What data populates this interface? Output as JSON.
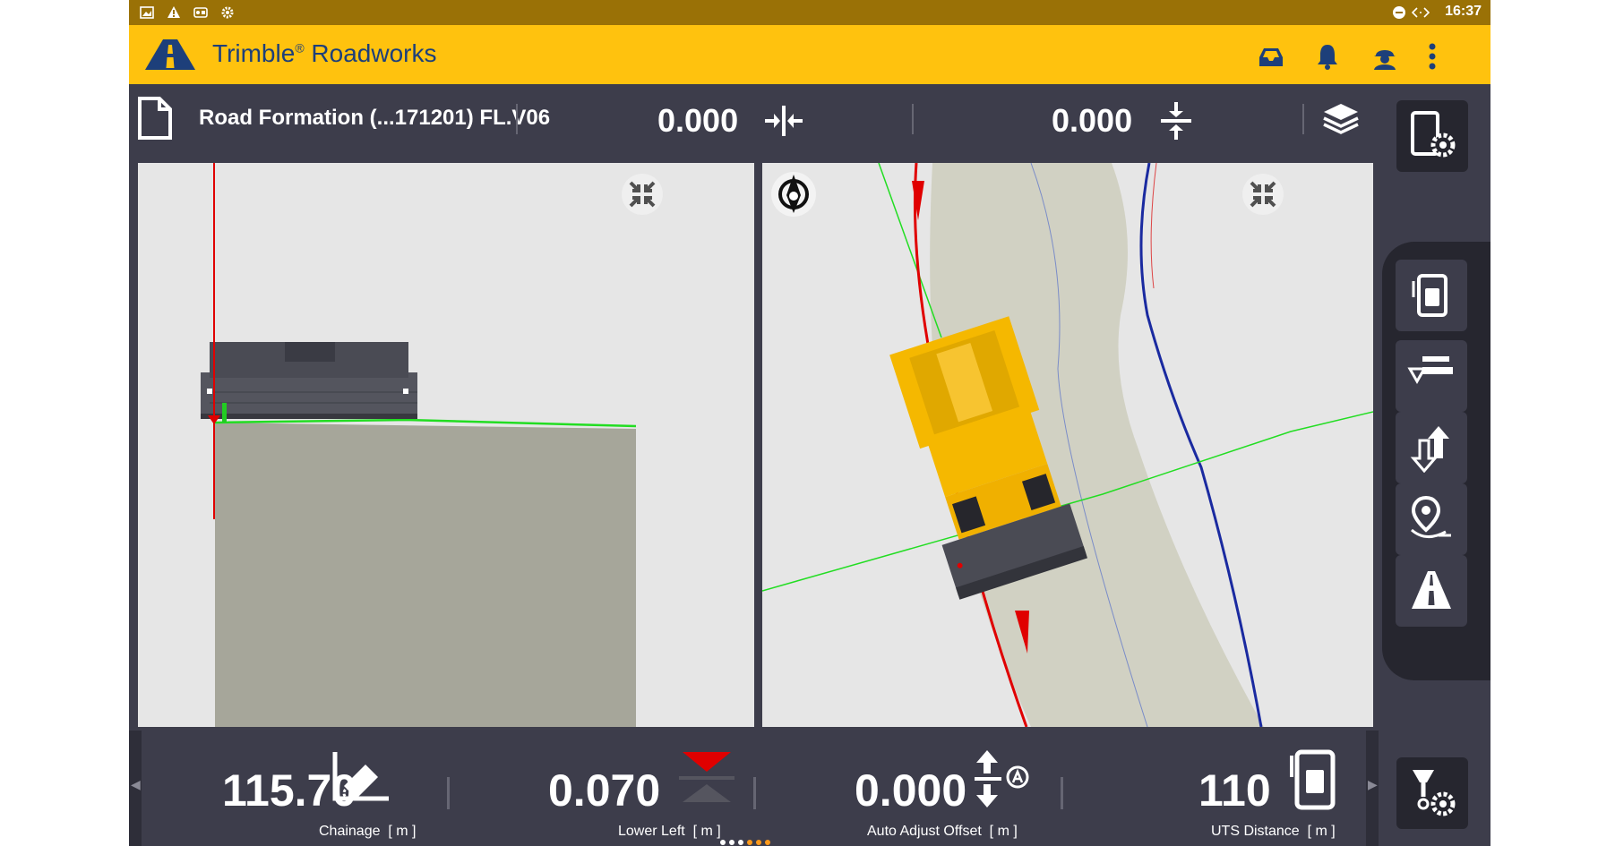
{
  "status_bar": {
    "time": "16:37",
    "left_icons": [
      "image-icon",
      "warning-icon",
      "cast-icon",
      "settings-cog-icon"
    ],
    "right_icons": [
      "do-not-disturb-icon",
      "code-icon"
    ]
  },
  "app_bar": {
    "title": "Trimble",
    "title_suffix": "Roadworks",
    "registered_mark": "®",
    "actions": [
      "inbox-icon",
      "bell-icon",
      "operator-icon",
      "more-vert-icon"
    ]
  },
  "info_bar": {
    "design_name": "Road Formation (...171201) FL.V06",
    "horizontal_offset": "0.000",
    "vertical_offset": "0.000"
  },
  "bottom_bar": {
    "readouts": [
      {
        "value": "115.70",
        "label": "Chainage",
        "unit": "[ m ]",
        "icon": "chainage-icon"
      },
      {
        "value": "0.070",
        "label": "Lower Left",
        "unit": "[ m ]",
        "icon": "cut-fill-icon"
      },
      {
        "value": "0.000",
        "label": "Auto Adjust Offset",
        "unit": "[ m ]",
        "icon": "auto-adjust-icon"
      },
      {
        "value": "110",
        "label": "UTS Distance",
        "unit": "[ m ]",
        "icon": "uts-icon"
      }
    ],
    "page_indicator": {
      "count": 6,
      "active": 3
    }
  },
  "right_rail": {
    "buttons": [
      "uts-instrument-icon",
      "paver-screed-icon",
      "offset-up-down-icon",
      "map-pin-icon",
      "road-icon"
    ]
  },
  "colors": {
    "status_bar": "#9a7106",
    "app_bar": "#ffc20e",
    "brand_blue": "#1d3f7a",
    "panel_dark": "#3d3d4b",
    "design_green": "#22dd22",
    "alignment_red": "#e00000",
    "alignment_blue": "#1a2aa0",
    "machine_yellow": "#f5b800"
  }
}
